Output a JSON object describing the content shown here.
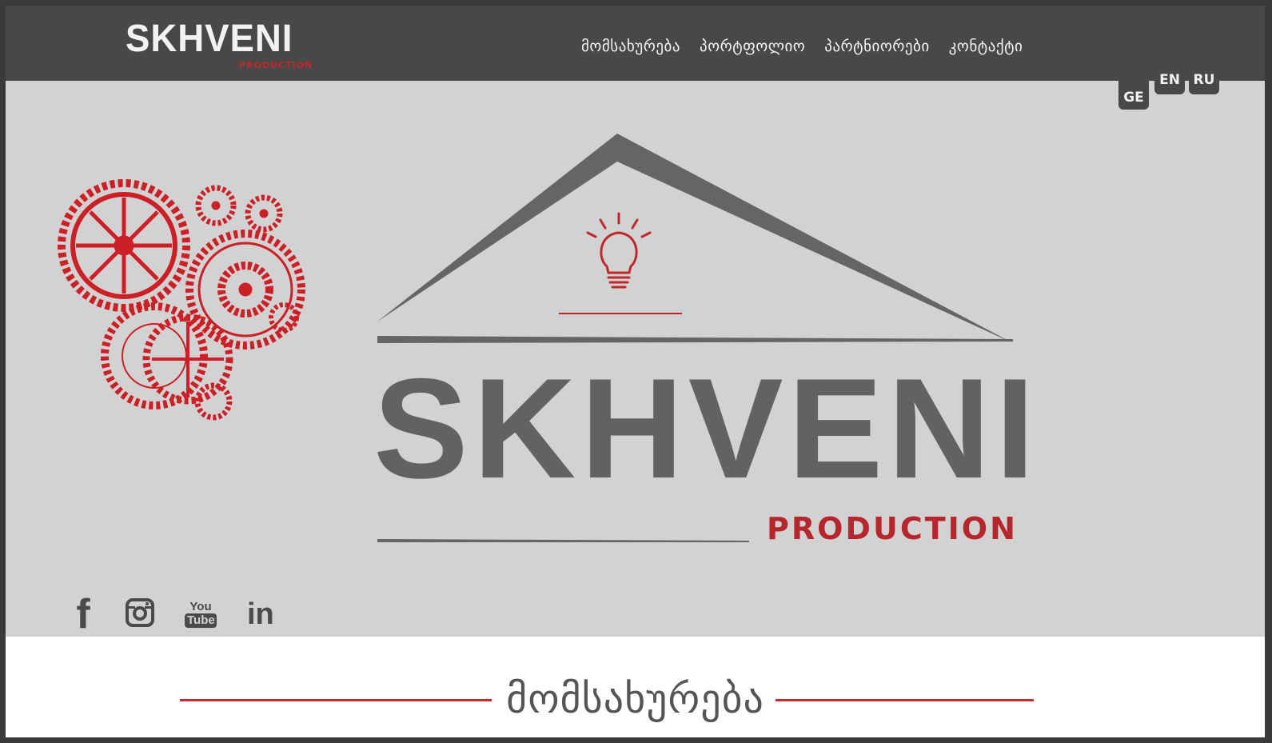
{
  "brand": {
    "name": "SKHVENI",
    "sub": "PRODUCTION"
  },
  "nav": {
    "items": [
      "მომსახურება",
      "პორტფოლიო",
      "პარტნიორები",
      "კონტაქტი"
    ]
  },
  "lang": {
    "ge": "GE",
    "en": "EN",
    "ru": "RU"
  },
  "hero": {
    "title": "SKHVENI",
    "subtitle": "PRODUCTION"
  },
  "social": {
    "facebook": "f",
    "youtube_top": "You",
    "youtube_bottom": "Tube",
    "linkedin": "in"
  },
  "section": {
    "title": "მომსახურება"
  },
  "colors": {
    "topbar": "#484848",
    "background": "#d3d2d3",
    "accent": "#c0272d",
    "logo_gray": "#636262"
  },
  "icons": [
    "gears-icon",
    "lightbulb-icon",
    "facebook-icon",
    "instagram-icon",
    "youtube-icon",
    "linkedin-icon"
  ]
}
